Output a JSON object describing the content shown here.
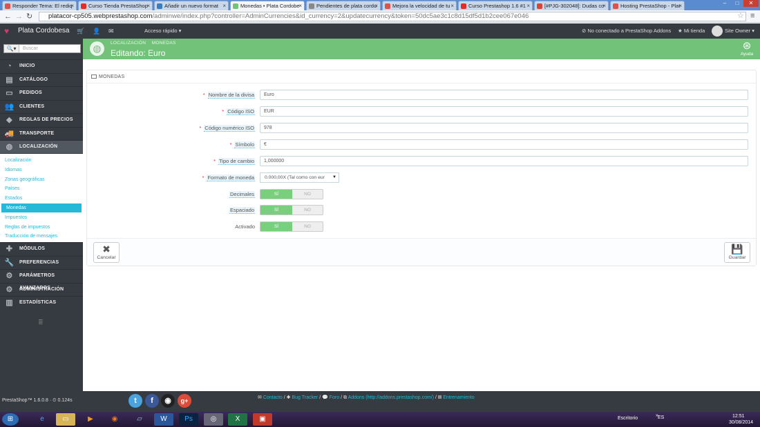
{
  "browser": {
    "tabs": [
      {
        "label": "Responder Tema: El rediq",
        "active": false,
        "color": "#d9534f"
      },
      {
        "label": "Curso Tienda PrestaShop",
        "active": false,
        "color": "#e52d27"
      },
      {
        "label": "Añadir un nuevo format",
        "active": false,
        "color": "#3b7bbf"
      },
      {
        "label": "Monedas • Plata Cordobe",
        "active": true,
        "color": "#72c279"
      },
      {
        "label": "Pendientes de plata cordo",
        "active": false,
        "color": "#888888"
      },
      {
        "label": "Mejora la velocidad de tu",
        "active": false,
        "color": "#d9534f"
      },
      {
        "label": "Curso Prestashop 1.6 #1",
        "active": false,
        "color": "#e52d27"
      },
      {
        "label": "[#PJG-302048]: Dudas co",
        "active": false,
        "color": "#d44638"
      },
      {
        "label": "Hosting PrestaShop - Plat",
        "active": false,
        "color": "#d9534f"
      }
    ],
    "url_host": "platacor-cp505.webprestashop.com",
    "url_path": "/adminwe/index.php?controller=AdminCurrencies&id_currency=2&updatecurrency&token=50dc5ae3c1c8d15df5d1b2cee067e046"
  },
  "topbar": {
    "shop_name": "Plata Cordobesa",
    "quick_access": "Acceso rápido",
    "addons_status": "No conectado a PrestaShop Addons",
    "my_shop": "Mi tienda",
    "user": "Site Owner"
  },
  "sidebar": {
    "search_placeholder": "Buscar",
    "menu_top": [
      {
        "label": "INICIO",
        "icon": "dashboard-icon"
      },
      {
        "label": "CATÁLOGO",
        "icon": "book-icon"
      },
      {
        "label": "PEDIDOS",
        "icon": "credit-card-icon"
      },
      {
        "label": "CLIENTES",
        "icon": "users-icon"
      },
      {
        "label": "REGLAS DE PRECIOS",
        "icon": "tag-icon"
      },
      {
        "label": "TRANSPORTE",
        "icon": "truck-icon"
      },
      {
        "label": "LOCALIZACIÓN",
        "icon": "globe-icon"
      }
    ],
    "submenu": [
      "Localización",
      "Idiomas",
      "Zonas geográficas",
      "Países",
      "Estados",
      "Monedas",
      "Impuestos",
      "Reglas de impuestos",
      "Traducción de mensajes"
    ],
    "menu_bottom": [
      {
        "label": "MÓDULOS",
        "icon": "puzzle-icon"
      },
      {
        "label": "PREFERENCIAS",
        "icon": "wrench-icon"
      },
      {
        "label": "PARÁMETROS AVANZADOS",
        "icon": "cogs-icon"
      },
      {
        "label": "ADMINISTRACIÓN",
        "icon": "gear-icon"
      },
      {
        "label": "ESTADÍSTICAS",
        "icon": "bar-chart-icon"
      }
    ],
    "version": "PrestaShop™ 1.6.0.8 · ⏲ 0.124s"
  },
  "page": {
    "breadcrumb_1": "LOCALIZACIÓN",
    "breadcrumb_2": "MONEDAS",
    "title": "Editando: Euro",
    "help": "Ayuda"
  },
  "form": {
    "panel_heading": "MONEDAS",
    "fields": {
      "name_label": "Nombre de la divisa",
      "name_value": "Euro",
      "iso_label": "Código ISO",
      "iso_value": "EUR",
      "isonum_label": "Código numérico ISO",
      "isonum_value": "978",
      "symbol_label": "Símbolo",
      "symbol_value": "€",
      "rate_label": "Tipo de cambio",
      "rate_value": "1,000000",
      "format_label": "Formato de moneda",
      "format_value": "0.000,00X (Tal como con eur",
      "decimals_label": "Decimales",
      "spacing_label": "Espaciado",
      "active_label": "Activado"
    },
    "yes": "SÍ",
    "no": "NO",
    "cancel": "Cancelar",
    "save": "Guardar"
  },
  "footer": {
    "contact": "Contacto",
    "bug": "Bug Tracker",
    "forum": "Foro",
    "addons": "Addons (http://addons.prestashop.com/)",
    "training": "Entrenamiento"
  },
  "taskbar": {
    "keyboard": "Escritorio",
    "lang": "ES",
    "time": "12:51",
    "date": "30/08/2014"
  }
}
